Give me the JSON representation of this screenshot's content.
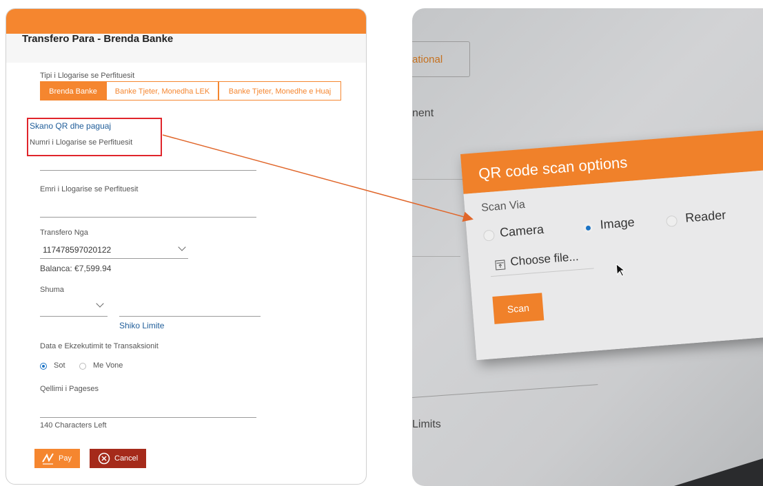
{
  "form": {
    "title": "Transfero Para - Brenda Banke",
    "account_type_label": "Tipi i Llogarise se Perfituesit",
    "tabs": [
      {
        "label": "Brenda Banke",
        "active": true
      },
      {
        "label": "Banke Tjeter, Monedha LEK",
        "active": false
      },
      {
        "label": "Banke Tjeter, Monedhe e Huaj",
        "active": false
      }
    ],
    "scan_qr_link": "Skano QR dhe paguaj",
    "beneficiary_account_label": "Numri i Llogarise se Perfituesit",
    "beneficiary_account_value": "",
    "beneficiary_name_label": "Emri i Llogarise se Perfituesit",
    "beneficiary_name_value": "",
    "transfer_from_label": "Transfero Nga",
    "transfer_from_value": "117478597020122",
    "balance_text": "Balanca: €7,599.94",
    "amount_label": "Shuma",
    "view_limits_link": "Shiko Limite",
    "execution_date_label": "Data e Ekzekutimit te Transaksionit",
    "date_options": [
      {
        "label": "Sot",
        "selected": true
      },
      {
        "label": "Me Vone",
        "selected": false
      }
    ],
    "purpose_label": "Qellimi i Pageses",
    "chars_left": "140 Characters Left",
    "pay_label": "Pay",
    "cancel_label": "Cancel"
  },
  "photo": {
    "bg_tab_text": "ational",
    "bg_text_1": "nent",
    "bg_text_2": "Limits",
    "modal": {
      "title": "QR code scan options",
      "scan_via_label": "Scan Via",
      "options": [
        {
          "label": "Camera",
          "selected": false
        },
        {
          "label": "Image",
          "selected": true
        },
        {
          "label": "Reader",
          "selected": false
        }
      ],
      "choose_file_label": "Choose file...",
      "scan_button": "Scan"
    }
  },
  "colors": {
    "accent_orange": "#f5862f",
    "cancel_red": "#a52a1a",
    "link_blue": "#1f5d99",
    "highlight_red": "#e0242a",
    "radio_blue": "#1a73c5"
  }
}
